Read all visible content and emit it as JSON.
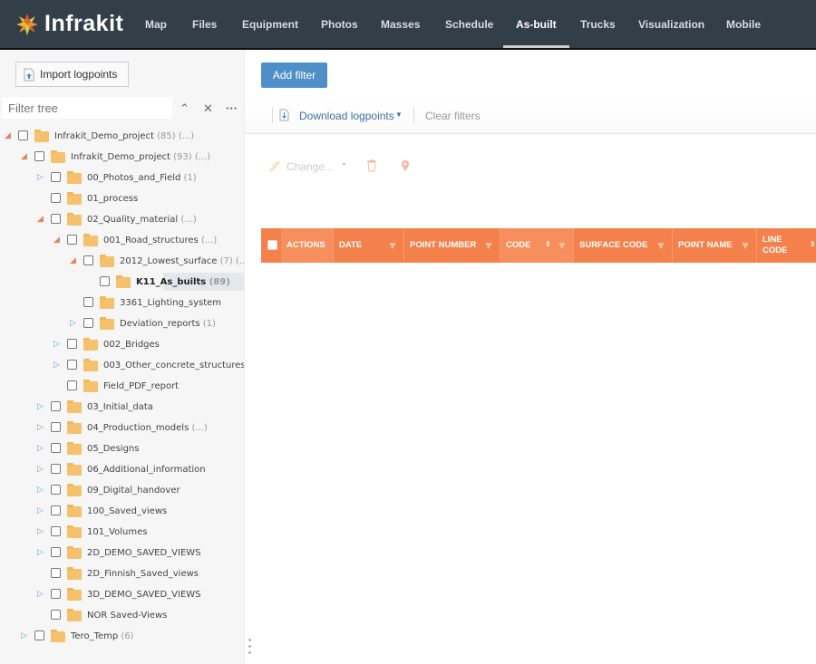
{
  "header": {
    "logo_text": "Infrakit",
    "nav": [
      "Map",
      "Files",
      "Equipment",
      "Photos",
      "Masses",
      "Schedule",
      "As-built",
      "Trucks",
      "Visualization",
      "Mobile"
    ],
    "active": "As-built"
  },
  "sidebar": {
    "import_label": "Import logpoints",
    "filter_placeholder": "Filter tree",
    "tree": [
      {
        "level": 0,
        "exp": "open",
        "label": "Infrakit_Demo_project",
        "count": "(85) (...)"
      },
      {
        "level": 1,
        "exp": "open",
        "label": "Infrakit_Demo_project",
        "count": "(93) (...)"
      },
      {
        "level": 2,
        "exp": "closed",
        "label": "00_Photos_and_Field",
        "count": "(1)"
      },
      {
        "level": 2,
        "exp": "",
        "label": "01_process",
        "count": ""
      },
      {
        "level": 2,
        "exp": "open",
        "label": "02_Quality_material",
        "count": "(...)"
      },
      {
        "level": 3,
        "exp": "open",
        "label": "001_Road_structures",
        "count": "(...)"
      },
      {
        "level": 4,
        "exp": "open",
        "label": "2012_Lowest_surface",
        "count": "(7) (..."
      },
      {
        "level": 5,
        "exp": "",
        "label": "K11_As_builts",
        "count": "(89)",
        "selected": true
      },
      {
        "level": 4,
        "exp": "",
        "label": "3361_Lighting_system",
        "count": ""
      },
      {
        "level": 4,
        "exp": "closed",
        "label": "Deviation_reports",
        "count": "(1)"
      },
      {
        "level": 3,
        "exp": "closed",
        "label": "002_Bridges",
        "count": ""
      },
      {
        "level": 3,
        "exp": "closed",
        "label": "003_Other_concrete_structures",
        "count": ""
      },
      {
        "level": 3,
        "exp": "",
        "label": "Field_PDF_report",
        "count": ""
      },
      {
        "level": 2,
        "exp": "closed",
        "label": "03_Initial_data",
        "count": ""
      },
      {
        "level": 2,
        "exp": "closed",
        "label": "04_Production_models",
        "count": "(...)"
      },
      {
        "level": 2,
        "exp": "closed",
        "label": "05_Designs",
        "count": ""
      },
      {
        "level": 2,
        "exp": "closed",
        "label": "06_Additional_information",
        "count": ""
      },
      {
        "level": 2,
        "exp": "closed",
        "label": "09_Digital_handover",
        "count": ""
      },
      {
        "level": 2,
        "exp": "closed",
        "label": "100_Saved_views",
        "count": ""
      },
      {
        "level": 2,
        "exp": "closed",
        "label": "101_Volumes",
        "count": ""
      },
      {
        "level": 2,
        "exp": "closed",
        "label": "2D_DEMO_SAVED_VIEWS",
        "count": ""
      },
      {
        "level": 2,
        "exp": "",
        "label": "2D_Finnish_Saved_views",
        "count": ""
      },
      {
        "level": 2,
        "exp": "closed",
        "label": "3D_DEMO_SAVED_VIEWS",
        "count": ""
      },
      {
        "level": 2,
        "exp": "",
        "label": "NOR Saved-Views",
        "count": ""
      },
      {
        "level": 1,
        "exp": "closed",
        "label": "Tero_Temp",
        "count": "(6)"
      }
    ]
  },
  "main": {
    "add_filter": "Add filter",
    "download": "Download logpoints",
    "clear_filters": "Clear filters",
    "change": "Change...",
    "columns": [
      {
        "label": "ACTIONS",
        "filter": false
      },
      {
        "label": "DATE",
        "filter": true
      },
      {
        "label": "POINT NUMBER",
        "filter": true
      },
      {
        "label": "CODE",
        "filter": true,
        "sort": true
      },
      {
        "label": "SURFACE CODE",
        "filter": true
      },
      {
        "label": "POINT NAME",
        "filter": true
      },
      {
        "label": "LINE CODE",
        "sort": true
      }
    ]
  },
  "colors": {
    "header": "#323e48",
    "accent": "#4f8fc9",
    "table_header": "#f4814b"
  }
}
